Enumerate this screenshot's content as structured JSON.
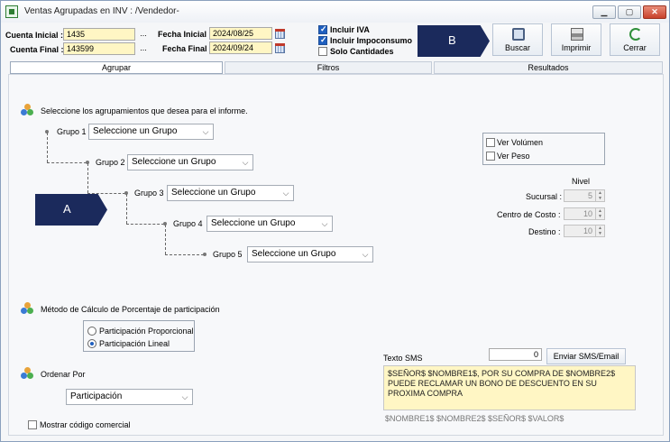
{
  "window": {
    "title": "Ventas Agrupadas en INV : /Vendedor-"
  },
  "header": {
    "cuenta_inicial_label": "Cuenta Inicial :",
    "cuenta_inicial_value": "1435",
    "cuenta_final_label": "Cuenta Final :",
    "cuenta_final_value": "143599",
    "fecha_inicial_label": "Fecha Inicial :",
    "fecha_inicial_value": "2024/08/25",
    "fecha_final_label": "Fecha Final :",
    "fecha_final_value": "2024/09/24",
    "browse_label": "...",
    "checks": [
      {
        "label": "Incluir IVA",
        "checked": true
      },
      {
        "label": "Incluir Impoconsumo",
        "checked": true
      },
      {
        "label": "Solo Cantidades",
        "checked": false
      }
    ]
  },
  "toolbar": {
    "buscar": "Buscar",
    "imprimir": "Imprimir",
    "cerrar": "Cerrar"
  },
  "annotations": {
    "a": "A",
    "b": "B"
  },
  "tabs": [
    {
      "label": "Agrupar",
      "active": true
    },
    {
      "label": "Filtros",
      "active": false
    },
    {
      "label": "Resultados",
      "active": false
    }
  ],
  "agrupar": {
    "heading": "Seleccione los agrupamientos que desea para el informe.",
    "groups": [
      {
        "label": "Grupo 1",
        "value": "Seleccione un Grupo"
      },
      {
        "label": "Grupo 2",
        "value": "Seleccione un Grupo"
      },
      {
        "label": "Grupo 3",
        "value": "Seleccione un Grupo"
      },
      {
        "label": "Grupo 4",
        "value": "Seleccione un Grupo"
      },
      {
        "label": "Grupo 5",
        "value": "Seleccione un Grupo"
      }
    ],
    "ver_volumen": "Ver Volúmen",
    "ver_peso": "Ver Peso",
    "nivel_label": "Nivel",
    "levels": [
      {
        "label": "Sucursal :",
        "value": "5"
      },
      {
        "label": "Centro de Costo :",
        "value": "10"
      },
      {
        "label": "Destino :",
        "value": "10"
      }
    ],
    "metodo_heading": "Método de Cálculo de Porcentaje de participación",
    "metodo_options": [
      {
        "label": "Participación Proporcional",
        "selected": false
      },
      {
        "label": "Participación Lineal",
        "selected": true
      }
    ],
    "ordenar_label": "Ordenar Por",
    "ordenar_value": "Participación",
    "mostrar_codigo": "Mostrar código comercial",
    "sms": {
      "label": "Texto SMS",
      "count": "0",
      "button": "Enviar SMS/Email",
      "text": "$SEÑOR$ $NOMBRE1$, POR SU COMPRA DE $NOMBRE2$ PUEDE RECLAMAR UN BONO DE DESCUENTO EN SU PROXIMA COMPRA",
      "tokens": "$NOMBRE1$  $NOMBRE2$  $SEÑOR$  $VALOR$"
    }
  },
  "colors": {
    "accent": "#1b2a5c",
    "input_bg": "#fff6c4",
    "check_blue": "#1f5fbf"
  }
}
